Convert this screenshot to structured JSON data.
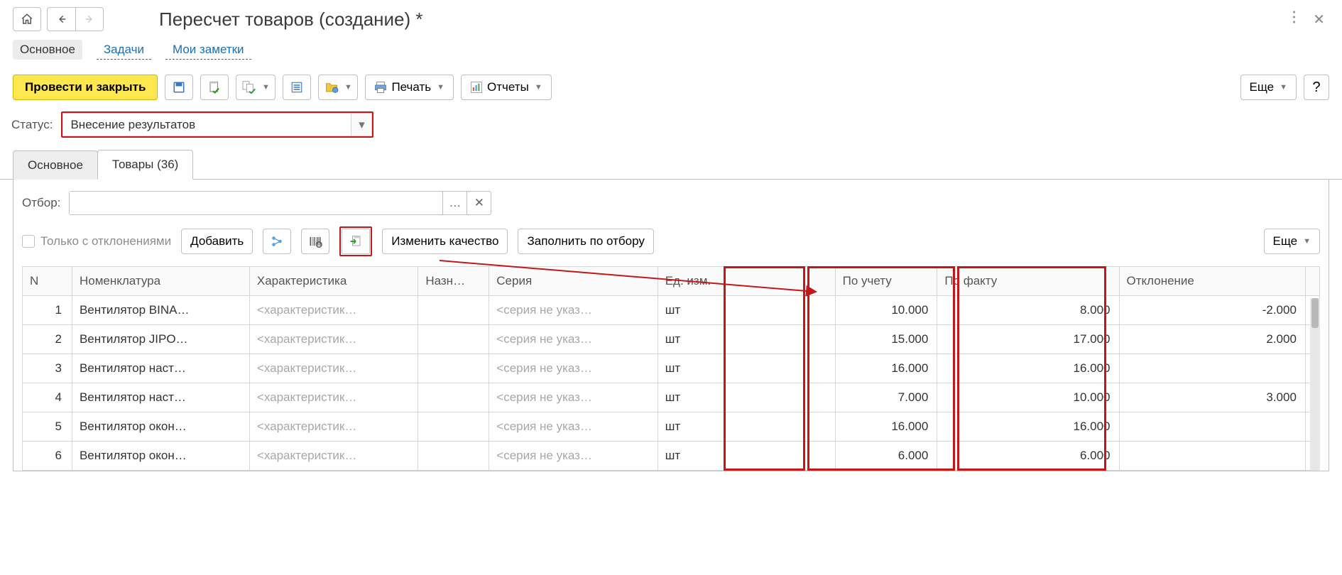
{
  "header": {
    "title": "Пересчет товаров (создание) *"
  },
  "linkbar": {
    "main": "Основное",
    "tasks": "Задачи",
    "notes": "Мои заметки"
  },
  "toolbar": {
    "post_and_close": "Провести и закрыть",
    "print": "Печать",
    "reports": "Отчеты",
    "more": "Еще",
    "help": "?"
  },
  "status": {
    "label": "Статус:",
    "value": "Внесение результатов"
  },
  "tabs": {
    "main": "Основное",
    "goods": "Товары (36)"
  },
  "filter": {
    "label": "Отбор:",
    "value": ""
  },
  "subtoolbar": {
    "only_deviations": "Только с отклонениями",
    "add": "Добавить",
    "change_quality": "Изменить качество",
    "fill_by_filter": "Заполнить по отбору",
    "more": "Еще"
  },
  "grid": {
    "headers": {
      "n": "N",
      "name": "Номенклатура",
      "char": "Характеристика",
      "nazn": "Назн…",
      "series": "Серия",
      "unit": "Ед. изм.",
      "account": "По учету",
      "fact": "По факту",
      "deviation": "Отклонение"
    },
    "char_placeholder": "<характеристик…",
    "series_placeholder": "<серия не указ…",
    "rows": [
      {
        "n": "1",
        "name": "Вентилятор BINA…",
        "unit": "шт",
        "account": "10.000",
        "fact": "8.000",
        "dev": "-2.000"
      },
      {
        "n": "2",
        "name": "Вентилятор JIPO…",
        "unit": "шт",
        "account": "15.000",
        "fact": "17.000",
        "dev": "2.000"
      },
      {
        "n": "3",
        "name": "Вентилятор наст…",
        "unit": "шт",
        "account": "16.000",
        "fact": "16.000",
        "dev": ""
      },
      {
        "n": "4",
        "name": "Вентилятор наст…",
        "unit": "шт",
        "account": "7.000",
        "fact": "10.000",
        "dev": "3.000"
      },
      {
        "n": "5",
        "name": "Вентилятор окон…",
        "unit": "шт",
        "account": "16.000",
        "fact": "16.000",
        "dev": ""
      },
      {
        "n": "6",
        "name": "Вентилятор окон…",
        "unit": "шт",
        "account": "6.000",
        "fact": "6.000",
        "dev": ""
      }
    ]
  }
}
